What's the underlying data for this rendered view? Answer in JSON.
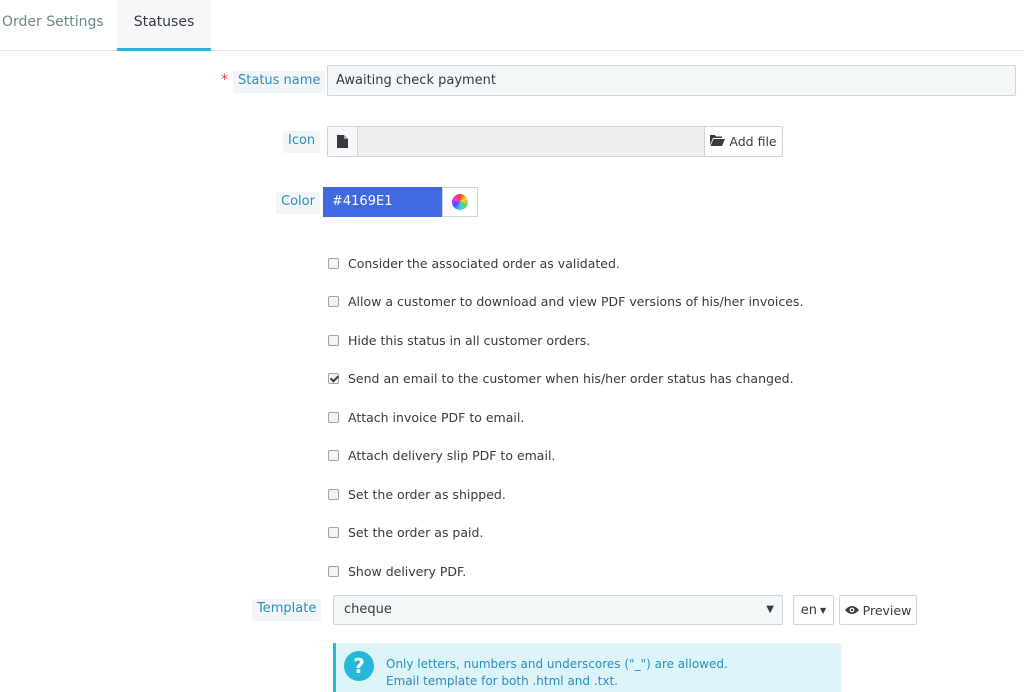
{
  "tabs": [
    {
      "label": "Order Settings"
    },
    {
      "label": "Statuses"
    }
  ],
  "form": {
    "status_name": {
      "label": "Status name",
      "required_mark": "*",
      "value": "Awaiting check payment"
    },
    "icon": {
      "label": "Icon",
      "add_file_label": "Add file"
    },
    "color": {
      "label": "Color",
      "value": "#4169E1"
    },
    "checkboxes": [
      {
        "label": "Consider the associated order as validated.",
        "checked": false
      },
      {
        "label": "Allow a customer to download and view PDF versions of his/her invoices.",
        "checked": false
      },
      {
        "label": "Hide this status in all customer orders.",
        "checked": false
      },
      {
        "label": "Send an email to the customer when his/her order status has changed.",
        "checked": true
      },
      {
        "label": "Attach invoice PDF to email.",
        "checked": false
      },
      {
        "label": "Attach delivery slip PDF to email.",
        "checked": false
      },
      {
        "label": "Set the order as shipped.",
        "checked": false
      },
      {
        "label": "Set the order as paid.",
        "checked": false
      },
      {
        "label": "Show delivery PDF.",
        "checked": false
      }
    ],
    "template": {
      "label": "Template",
      "value": "cheque",
      "lang": "en",
      "preview_label": "Preview"
    }
  },
  "info": {
    "icon": "?",
    "line1": "Only letters, numbers and underscores (\"_\") are allowed.",
    "line2": "Email template for both .html and .txt."
  },
  "colors": {
    "accent": "#25b9d7",
    "swatch": "#4169e1"
  }
}
